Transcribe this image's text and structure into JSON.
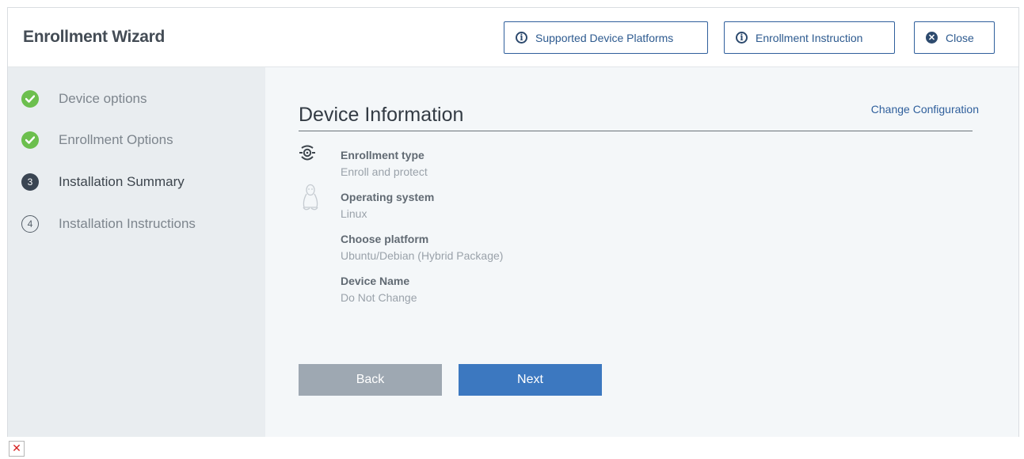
{
  "header": {
    "title": "Enrollment Wizard",
    "supported_platforms_label": "Supported Device Platforms",
    "enrollment_instruction_label": "Enrollment Instruction",
    "close_label": "Close"
  },
  "steps": [
    {
      "number": "1",
      "label": "Device options",
      "state": "done"
    },
    {
      "number": "2",
      "label": "Enrollment Options",
      "state": "done"
    },
    {
      "number": "3",
      "label": "Installation Summary",
      "state": "active"
    },
    {
      "number": "4",
      "label": "Installation Instructions",
      "state": "pending"
    }
  ],
  "main": {
    "section_title": "Device Information",
    "change_link": "Change Configuration",
    "fields": [
      {
        "name": "Enrollment type",
        "value": "Enroll and protect",
        "icon": "enrollment-type-icon"
      },
      {
        "name": "Operating system",
        "value": "Linux",
        "icon": "linux-penguin-icon"
      },
      {
        "name": "Choose platform",
        "value": "Ubuntu/Debian (Hybrid Package)"
      },
      {
        "name": "Device Name",
        "value": "Do Not Change"
      }
    ],
    "back_label": "Back",
    "next_label": "Next"
  },
  "colors": {
    "accent": "#3c78c0",
    "done": "#6cbf4e",
    "active": "#3a4552",
    "sidebar_bg": "#e9edf0",
    "main_bg": "#f4f7f9"
  }
}
